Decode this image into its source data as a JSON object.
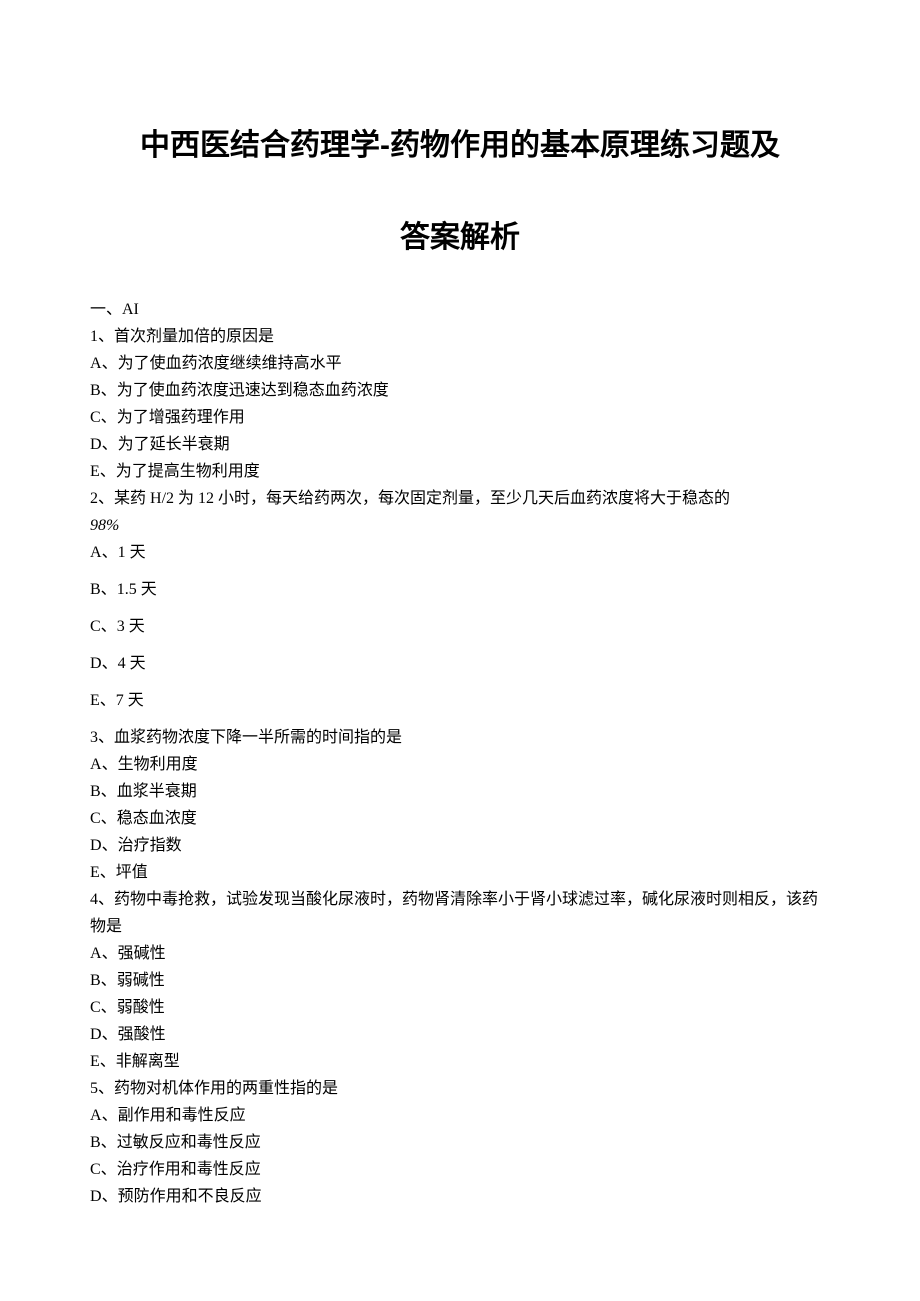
{
  "title": {
    "line1": "中西医结合药理学-药物作用的基本原理练习题及",
    "line2": "答案解析"
  },
  "section_label": "一、AI",
  "questions": [
    {
      "num": "1",
      "stem": "首次剂量加倍的原因是",
      "options": [
        {
          "letter": "A",
          "text": "为了使血药浓度继续维持高水平"
        },
        {
          "letter": "B",
          "text": "为了使血药浓度迅速达到稳态血药浓度"
        },
        {
          "letter": "C",
          "text": "为了增强药理作用"
        },
        {
          "letter": "D",
          "text": "为了延长半衰期"
        },
        {
          "letter": "E",
          "text": "为了提高生物利用度"
        }
      ]
    },
    {
      "num": "2",
      "stem_pre": "某药 H/2 为 12 小时，每天给药两次，每次固定剂量，至少几天后血药浓度将大于稳态的",
      "stem_italic": "98%",
      "options": [
        {
          "letter": "A",
          "text": "1 天"
        },
        {
          "letter": "B",
          "text": "1.5 天"
        },
        {
          "letter": "C",
          "text": "3 天"
        },
        {
          "letter": "D",
          "text": "4 天"
        },
        {
          "letter": "E",
          "text": "7 天"
        }
      ],
      "spaced": true
    },
    {
      "num": "3",
      "stem": "血浆药物浓度下降一半所需的时间指的是",
      "options": [
        {
          "letter": "A",
          "text": "生物利用度"
        },
        {
          "letter": "B",
          "text": "血浆半衰期"
        },
        {
          "letter": "C",
          "text": "稳态血浓度"
        },
        {
          "letter": "D",
          "text": "治疗指数"
        },
        {
          "letter": "E",
          "text": "坪值"
        }
      ]
    },
    {
      "num": "4",
      "stem": "药物中毒抢救，试验发现当酸化尿液时，药物肾清除率小于肾小球滤过率，碱化尿液时则相反，该药物是",
      "options": [
        {
          "letter": "A",
          "text": "强碱性"
        },
        {
          "letter": "B",
          "text": "弱碱性"
        },
        {
          "letter": "C",
          "text": "弱酸性"
        },
        {
          "letter": "D",
          "text": "强酸性"
        },
        {
          "letter": "E",
          "text": "非解离型"
        }
      ]
    },
    {
      "num": "5",
      "stem": "药物对机体作用的两重性指的是",
      "options": [
        {
          "letter": "A",
          "text": "副作用和毒性反应"
        },
        {
          "letter": "B",
          "text": "过敏反应和毒性反应"
        },
        {
          "letter": "C",
          "text": "治疗作用和毒性反应"
        },
        {
          "letter": "D",
          "text": "预防作用和不良反应"
        }
      ]
    }
  ]
}
